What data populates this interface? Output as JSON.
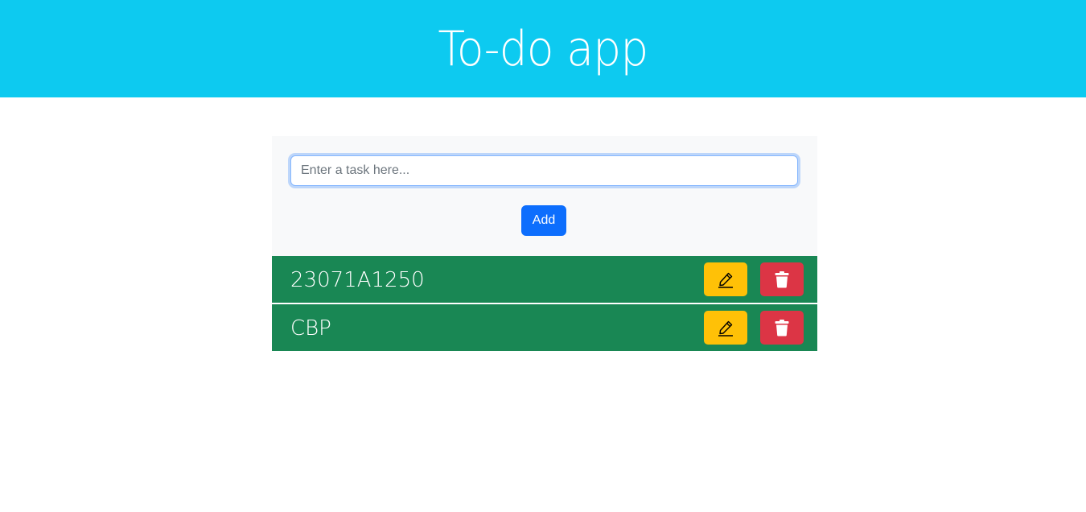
{
  "header": {
    "title": "To-do app"
  },
  "form": {
    "input_placeholder": "Enter a task here...",
    "input_value": "",
    "add_label": "Add"
  },
  "tasks": [
    {
      "text": "23071A1250",
      "edit_icon": "pencil-icon",
      "delete_icon": "trash-icon"
    },
    {
      "text": "CBP",
      "edit_icon": "pencil-icon",
      "delete_icon": "trash-icon"
    }
  ],
  "colors": {
    "header_bg": "#0dcaf0",
    "panel_bg": "#f8f9fa",
    "add_button": "#0d6efd",
    "task_bg": "#198754",
    "edit_button": "#ffc107",
    "delete_button": "#dc3545"
  }
}
